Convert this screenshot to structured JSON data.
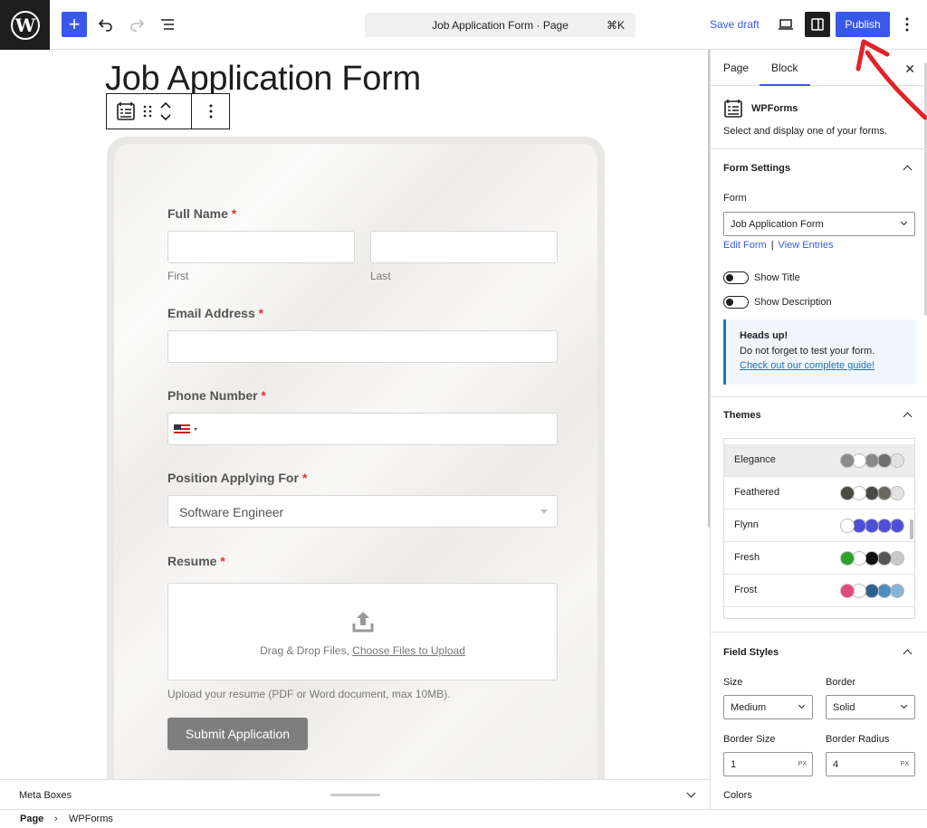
{
  "topbar": {
    "command_bar": "Job Application Form · Page",
    "command_shortcut": "⌘K",
    "save_draft": "Save draft",
    "publish": "Publish"
  },
  "canvas": {
    "page_title": "Job Application Form",
    "form": {
      "full_name_label": "Full Name",
      "first_sublabel": "First",
      "last_sublabel": "Last",
      "email_label": "Email Address",
      "phone_label": "Phone Number",
      "position_label": "Position Applying For",
      "position_value": "Software Engineer",
      "resume_label": "Resume",
      "upload_text": "Drag & Drop Files,",
      "upload_link": "Choose Files to Upload",
      "upload_description": "Upload your resume (PDF or Word document, max 10MB).",
      "submit": "Submit Application",
      "required_mark": "*"
    }
  },
  "sidebar": {
    "tabs": [
      "Page",
      "Block"
    ],
    "active_tab": "Block",
    "close": "✕",
    "block_name": "WPForms",
    "block_description": "Select and display one of your forms.",
    "form_settings": {
      "title": "Form Settings",
      "form_label": "Form",
      "form_value": "Job Application Form",
      "edit_form": "Edit Form",
      "separator": "|",
      "view_entries": "View Entries",
      "show_title": "Show Title",
      "show_description": "Show Description"
    },
    "notice": {
      "title": "Heads up!",
      "body": "Do not forget to test your form.",
      "link": "Check out our complete guide!"
    },
    "themes": {
      "title": "Themes",
      "items": [
        {
          "name": "Elegance",
          "colors": [
            "#8a8a8a",
            "#ffffff",
            "#8a8a8a",
            "#6f6f6f",
            "#e2e2e2"
          ]
        },
        {
          "name": "Feathered",
          "colors": [
            "#4a4944",
            "#ffffff",
            "#4a4944",
            "#6b6860",
            "#e2e2e2"
          ]
        },
        {
          "name": "Flynn",
          "colors": [
            "#ffffff",
            "#4f4fd9",
            "#4f4fd9",
            "#4f4fd9",
            "#4f4fd9"
          ]
        },
        {
          "name": "Fresh",
          "colors": [
            "#2ea12a",
            "#ffffff",
            "#101010",
            "#555555",
            "#c8c8c8"
          ]
        },
        {
          "name": "Frost",
          "colors": [
            "#e04a7a",
            "#ffffff",
            "#2f5f8f",
            "#4e8fbf",
            "#8ab4d4"
          ]
        }
      ]
    },
    "field_styles": {
      "title": "Field Styles",
      "size_label": "Size",
      "size_value": "Medium",
      "border_label": "Border",
      "border_value": "Solid",
      "border_size_label": "Border Size",
      "border_size_value": "1",
      "border_radius_label": "Border Radius",
      "border_radius_value": "4",
      "unit": "PX",
      "colors_label": "Colors"
    }
  },
  "bottom": {
    "meta_boxes": "Meta Boxes",
    "breadcrumb": [
      "Page",
      "WPForms"
    ],
    "breadcrumb_sep": "›"
  },
  "colors": {
    "accent": "#3858e9",
    "annotation": "#e0242a",
    "notice_border": "#2271b1"
  }
}
